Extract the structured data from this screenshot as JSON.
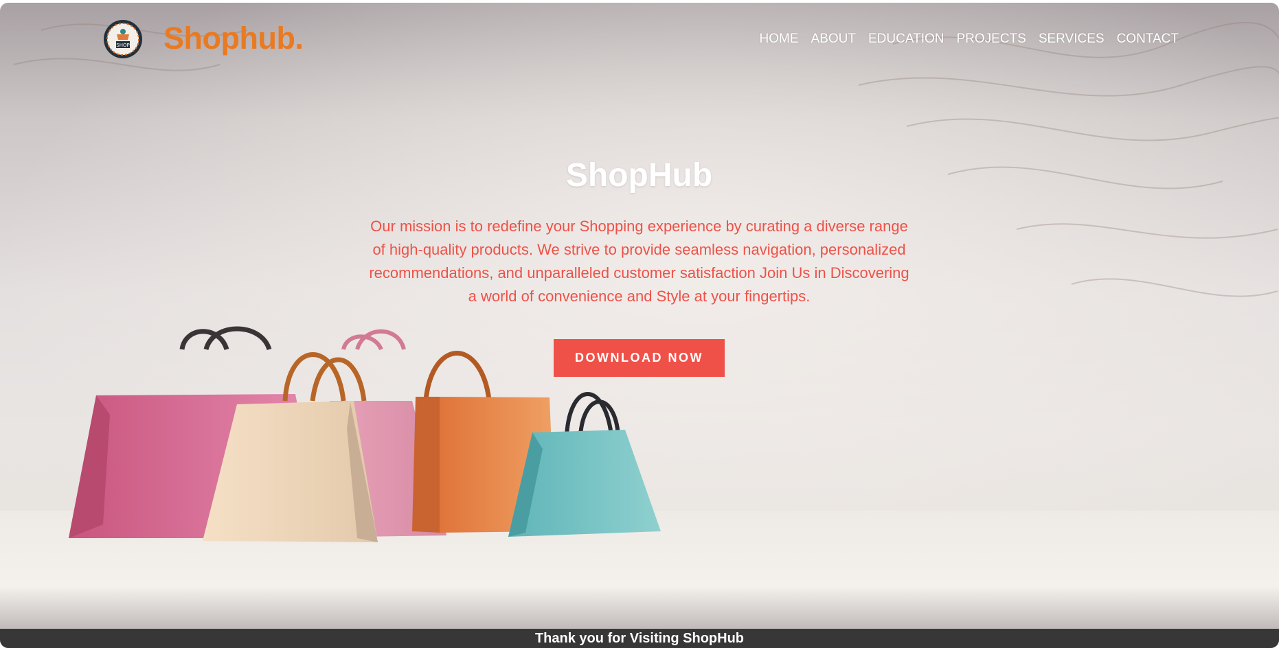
{
  "header": {
    "logo_icon": "shophub-badge-logo",
    "brand": "Shophub."
  },
  "nav": {
    "items": [
      {
        "label": "HOME"
      },
      {
        "label": "ABOUT"
      },
      {
        "label": "EDUCATION"
      },
      {
        "label": "PROJECTS"
      },
      {
        "label": "SERVICES"
      },
      {
        "label": "CONTACT"
      }
    ]
  },
  "hero": {
    "title": "ShopHub",
    "text": "Our mission is to redefine your Shopping experience by curating a diverse range of high-quality products. We strive to provide seamless navigation, personalized recommendations, and unparalleled customer satisfaction Join Us in Discovering a world of convenience and Style at your fingertips.",
    "button_label": "DOWNLOAD NOW",
    "image_subject": "shopping-bags-photo"
  },
  "footer": {
    "text": "Thank you for Visiting ShopHub"
  },
  "colors": {
    "brand_orange": "#e97a22",
    "accent_red": "#ef5149",
    "footer_bg": "#373737",
    "nav_text": "#ffffff"
  }
}
